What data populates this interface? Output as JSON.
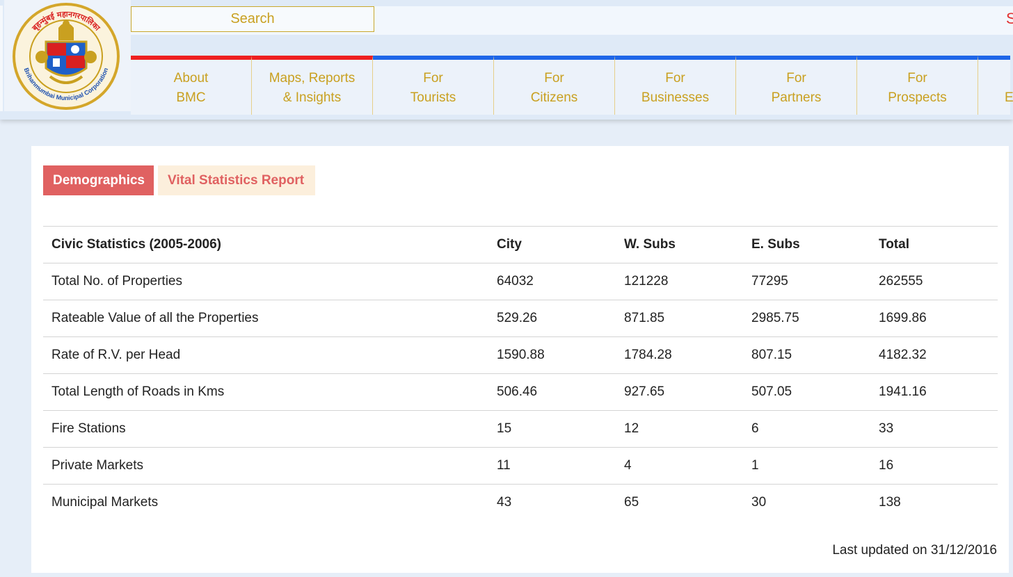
{
  "header": {
    "logo": {
      "hindi_text": "बृहन्मुंबई महानगरपालिका",
      "english_text": "Brihanmumbai Municipal Corporation"
    },
    "search": {
      "label": "Search"
    },
    "edge_text": "S",
    "nav": [
      {
        "line1": "About",
        "line2": "BMC",
        "accent": "red"
      },
      {
        "line1": "Maps, Reports",
        "line2": "& Insights",
        "accent": "red"
      },
      {
        "line1": "For",
        "line2": "Tourists",
        "accent": "blue"
      },
      {
        "line1": "For",
        "line2": "Citizens",
        "accent": "blue"
      },
      {
        "line1": "For",
        "line2": "Businesses",
        "accent": "blue"
      },
      {
        "line1": "For",
        "line2": "Partners",
        "accent": "blue"
      },
      {
        "line1": "For",
        "line2": "Prospects",
        "accent": "blue"
      },
      {
        "line1": "",
        "line2": "E",
        "accent": "blue"
      }
    ]
  },
  "tabs": [
    {
      "label": "Demographics",
      "active": true
    },
    {
      "label": "Vital Statistics Report",
      "active": false
    }
  ],
  "table": {
    "headers": [
      "Civic Statistics (2005-2006)",
      "City",
      "W. Subs",
      "E. Subs",
      "Total"
    ],
    "rows": [
      [
        "Total No. of Properties",
        "64032",
        "121228",
        "77295",
        "262555"
      ],
      [
        "Rateable Value of all the Properties",
        "529.26",
        "871.85",
        "2985.75",
        "1699.86"
      ],
      [
        "Rate of R.V. per Head",
        "1590.88",
        "1784.28",
        "807.15",
        "4182.32"
      ],
      [
        "Total Length of Roads in Kms",
        "506.46",
        "927.65",
        "507.05",
        "1941.16"
      ],
      [
        "Fire Stations",
        "15",
        "12",
        "6",
        "33"
      ],
      [
        "Private Markets",
        "11",
        "4",
        "1",
        "16"
      ],
      [
        "Municipal Markets",
        "43",
        "65",
        "30",
        "138"
      ]
    ]
  },
  "last_updated": "Last updated on 31/12/2016",
  "colors": {
    "accent_red": "#e06161",
    "nav_gold": "#c9a020",
    "nav_blue": "#1e66e8",
    "nav_red": "#ee2020"
  }
}
